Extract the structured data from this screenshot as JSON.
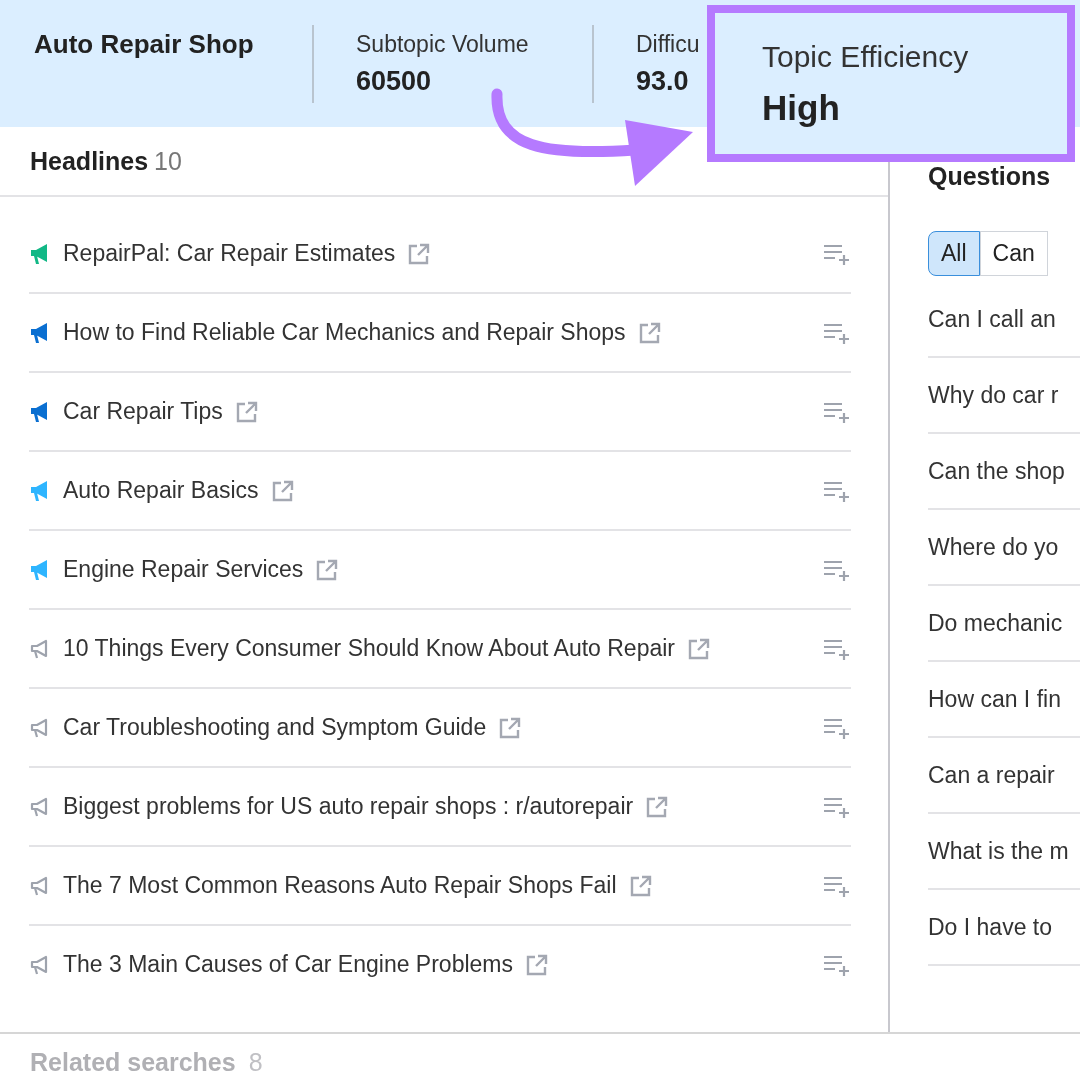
{
  "header": {
    "topic": "Auto Repair Shop",
    "metrics": [
      {
        "label": "Subtopic Volume",
        "value": "60500"
      },
      {
        "label": "Difficu",
        "value": "93.0"
      }
    ]
  },
  "callout": {
    "label": "Topic Efficiency",
    "value": "High"
  },
  "headlines": {
    "title": "Headlines",
    "count": "10",
    "items": [
      {
        "text": "RepairPal: Car Repair Estimates",
        "kind": "filled",
        "color": "#12b886"
      },
      {
        "text": "How to Find Reliable Car Mechanics and Repair Shops",
        "kind": "filled",
        "color": "#0a6fd1"
      },
      {
        "text": "Car Repair Tips",
        "kind": "filled",
        "color": "#0a6fd1"
      },
      {
        "text": "Auto Repair Basics",
        "kind": "filled",
        "color": "#2eb5ff"
      },
      {
        "text": "Engine Repair Services",
        "kind": "filled",
        "color": "#2eb5ff"
      },
      {
        "text": "10 Things Every Consumer Should Know About Auto Repair",
        "kind": "outline",
        "color": "#9ea3ad"
      },
      {
        "text": "Car Troubleshooting and Symptom Guide",
        "kind": "outline",
        "color": "#9ea3ad"
      },
      {
        "text": "Biggest problems for US auto repair shops : r/autorepair",
        "kind": "outline",
        "color": "#9ea3ad"
      },
      {
        "text": "The 7 Most Common Reasons Auto Repair Shops Fail",
        "kind": "outline",
        "color": "#9ea3ad"
      },
      {
        "text": "The 3 Main Causes of Car Engine Problems",
        "kind": "outline",
        "color": "#9ea3ad"
      }
    ]
  },
  "questions": {
    "title": "Questions",
    "tabs": [
      {
        "label": "All",
        "selected": true
      },
      {
        "label": "Can",
        "selected": false
      }
    ],
    "items": [
      "Can I call an",
      "Why do car r",
      "Can the shop",
      "Where do yo",
      "Do mechanic",
      "How can I fin",
      "Can a repair",
      "What is the m",
      "Do I have to"
    ]
  },
  "related": {
    "title": "Related searches",
    "count": "8"
  }
}
